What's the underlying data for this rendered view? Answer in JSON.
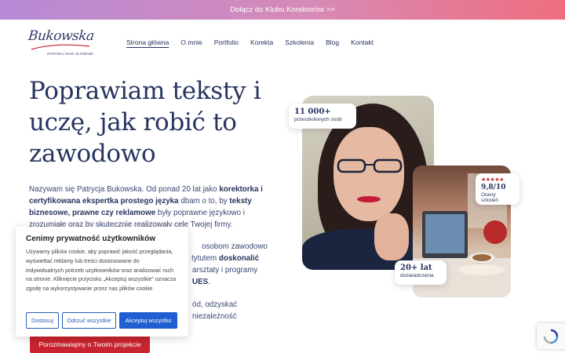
{
  "topbar": {
    "link": "Dołącz do Klubu Korektorów >>"
  },
  "logo": {
    "script": "Bukowska",
    "tagline": "ZAPANUJ NAD SŁOWAMI"
  },
  "nav": {
    "items": [
      {
        "label": "Strona główna",
        "active": true
      },
      {
        "label": "O mnie"
      },
      {
        "label": "Portfolio"
      },
      {
        "label": "Korekta"
      },
      {
        "label": "Szkolenia"
      },
      {
        "label": "Blog"
      },
      {
        "label": "Kontakt"
      }
    ]
  },
  "hero": {
    "title": "Poprawiam teksty i uczę, jak robić to zawodowo",
    "intro_a": "Nazywam się Patrycja Bukowska. Od ponad 20 lat jako ",
    "intro_b": "korektorka i certyfikowana ekspertka prostego języka",
    "intro_c": " dbam o to, by ",
    "intro_d": "teksty biznesowe, prawne czy reklamowe",
    "intro_e": " były poprawne językowo i zrozumiałe oraz by skutecznie realizowały cele Twojej firmy.",
    "para2_a": "osobom zawodowo",
    "para2_b": "tytutem ",
    "para2_c": "doskonalić",
    "para2_d": "arsztaty i programy",
    "para2_e": "UES",
    "para3": "ód, odzyskać niezależność",
    "cta": "Porozmawiajmy o Twoim projekcie"
  },
  "badges": {
    "trained": {
      "value": "11 000+",
      "label": "przeszkolonych osób"
    },
    "rating": {
      "stars": "★★★★★",
      "value": "9,8/10",
      "label": "Oceny szkoleń"
    },
    "experience": {
      "value": "20+ lat",
      "label": "doświadczenia"
    }
  },
  "cookie": {
    "title": "Cenimy prywatność użytkowników",
    "text": "Używamy plików cookie, aby poprawić jakość przeglądania, wyświetlać reklamy lub treści dostosowane do indywidualnych potrzeb użytkowników oraz analizować ruch na stronie. Kliknięcie przycisku „Akceptuj wszystkie” oznacza zgodę na wykorzystywanie przez nas plików cookie.",
    "customize": "Dostosuj",
    "reject": "Odrzuć wszystkie",
    "accept": "Akceptuj wszystko"
  },
  "colors": {
    "brand": "#27345f",
    "cta": "#c8242f",
    "accept": "#1f5fd1"
  },
  "icons": {
    "recaptcha": "recaptcha-icon"
  }
}
